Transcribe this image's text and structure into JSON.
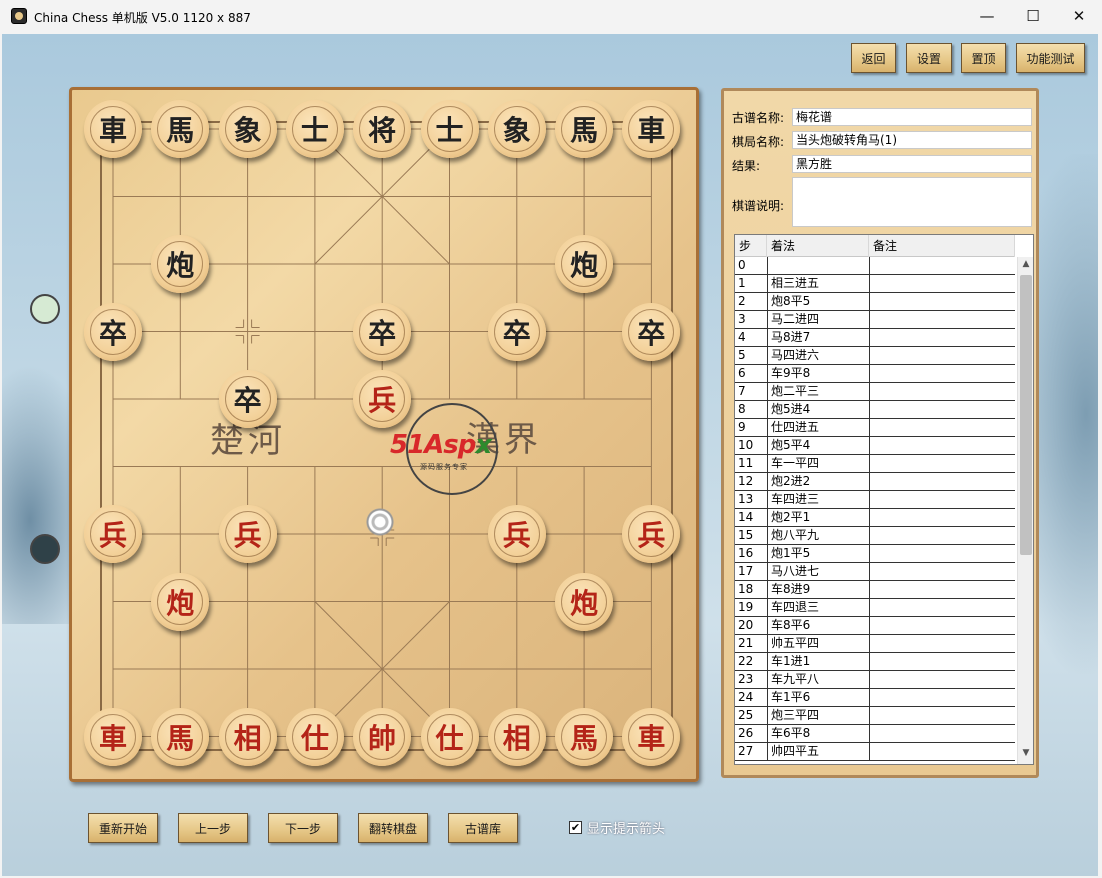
{
  "window": {
    "title": "China Chess 单机版 V5.0  1120 x 887",
    "minimize": "—",
    "maximize": "☐",
    "close": "✕"
  },
  "toolbar": {
    "back": "返回",
    "settings": "设置",
    "pin_top": "置顶",
    "feature_test": "功能测试"
  },
  "board": {
    "river_left": "楚河",
    "river_right": "漢界",
    "watermark_main": "51Asp",
    "watermark_x": "x",
    "watermark_sub": "源码服务专家",
    "pieces": [
      {
        "label": "車",
        "side": "black",
        "col": 0,
        "row": 0
      },
      {
        "label": "馬",
        "side": "black",
        "col": 1,
        "row": 0
      },
      {
        "label": "象",
        "side": "black",
        "col": 2,
        "row": 0
      },
      {
        "label": "士",
        "side": "black",
        "col": 3,
        "row": 0
      },
      {
        "label": "将",
        "side": "black",
        "col": 4,
        "row": 0
      },
      {
        "label": "士",
        "side": "black",
        "col": 5,
        "row": 0
      },
      {
        "label": "象",
        "side": "black",
        "col": 6,
        "row": 0
      },
      {
        "label": "馬",
        "side": "black",
        "col": 7,
        "row": 0
      },
      {
        "label": "車",
        "side": "black",
        "col": 8,
        "row": 0
      },
      {
        "label": "炮",
        "side": "black",
        "col": 1,
        "row": 2
      },
      {
        "label": "炮",
        "side": "black",
        "col": 7,
        "row": 2
      },
      {
        "label": "卒",
        "side": "black",
        "col": 0,
        "row": 3
      },
      {
        "label": "卒",
        "side": "black",
        "col": 4,
        "row": 3
      },
      {
        "label": "卒",
        "side": "black",
        "col": 6,
        "row": 3
      },
      {
        "label": "卒",
        "side": "black",
        "col": 8,
        "row": 3
      },
      {
        "label": "卒",
        "side": "black",
        "col": 2,
        "row": 4
      },
      {
        "label": "兵",
        "side": "red",
        "col": 4,
        "row": 4
      },
      {
        "label": "兵",
        "side": "red",
        "col": 0,
        "row": 6
      },
      {
        "label": "兵",
        "side": "red",
        "col": 2,
        "row": 6
      },
      {
        "label": "兵",
        "side": "red",
        "col": 6,
        "row": 6
      },
      {
        "label": "兵",
        "side": "red",
        "col": 8,
        "row": 6
      },
      {
        "label": "炮",
        "side": "red",
        "col": 1,
        "row": 7
      },
      {
        "label": "炮",
        "side": "red",
        "col": 7,
        "row": 7
      },
      {
        "label": "車",
        "side": "red",
        "col": 0,
        "row": 9
      },
      {
        "label": "馬",
        "side": "red",
        "col": 1,
        "row": 9
      },
      {
        "label": "相",
        "side": "red",
        "col": 2,
        "row": 9
      },
      {
        "label": "仕",
        "side": "red",
        "col": 3,
        "row": 9
      },
      {
        "label": "帥",
        "side": "red",
        "col": 4,
        "row": 9
      },
      {
        "label": "仕",
        "side": "red",
        "col": 5,
        "row": 9
      },
      {
        "label": "相",
        "side": "red",
        "col": 6,
        "row": 9
      },
      {
        "label": "馬",
        "side": "red",
        "col": 7,
        "row": 9
      },
      {
        "label": "車",
        "side": "red",
        "col": 8,
        "row": 9
      }
    ]
  },
  "info": {
    "book_name_label": "古谱名称:",
    "book_name": "梅花谱",
    "game_name_label": "棋局名称:",
    "game_name": "当头炮破转角马(1)",
    "result_label": "结果:",
    "result": "黑方胜",
    "desc_label": "棋谱说明:",
    "desc": ""
  },
  "moves_table": {
    "headers": [
      "步",
      "着法",
      "备注"
    ],
    "rows": [
      [
        "0",
        ""
      ],
      [
        "1",
        "相三进五"
      ],
      [
        "2",
        "炮8平5"
      ],
      [
        "3",
        "马二进四"
      ],
      [
        "4",
        "马8进7"
      ],
      [
        "5",
        "马四进六"
      ],
      [
        "6",
        "车9平8"
      ],
      [
        "7",
        "炮二平三"
      ],
      [
        "8",
        "炮5进4"
      ],
      [
        "9",
        "仕四进五"
      ],
      [
        "10",
        "炮5平4"
      ],
      [
        "11",
        "车一平四"
      ],
      [
        "12",
        "炮2进2"
      ],
      [
        "13",
        "车四进三"
      ],
      [
        "14",
        "炮2平1"
      ],
      [
        "15",
        "炮八平九"
      ],
      [
        "16",
        "炮1平5"
      ],
      [
        "17",
        "马八进七"
      ],
      [
        "18",
        "车8进9"
      ],
      [
        "19",
        "车四退三"
      ],
      [
        "20",
        "车8平6"
      ],
      [
        "21",
        "帅五平四"
      ],
      [
        "22",
        "车1进1"
      ],
      [
        "23",
        "车九平八"
      ],
      [
        "24",
        "车1平6"
      ],
      [
        "25",
        "炮三平四"
      ],
      [
        "26",
        "车6平8"
      ],
      [
        "27",
        "帅四平五"
      ]
    ]
  },
  "controls": {
    "restart": "重新开始",
    "prev": "上一步",
    "next": "下一步",
    "flip": "翻转棋盘",
    "library": "古谱库",
    "show_hint_arrow": "显示提示箭头",
    "checked": "✔"
  },
  "colors": {
    "red_piece": "#b42418",
    "black_piece": "#222222",
    "board_border": "#a86f36"
  }
}
